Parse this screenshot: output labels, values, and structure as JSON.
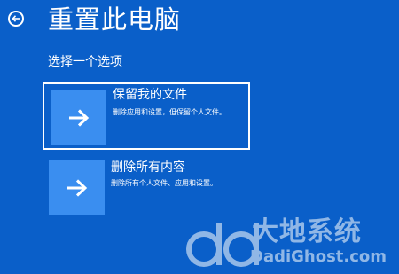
{
  "header": {
    "title": "重置此电脑",
    "back_icon": "back-arrow-icon"
  },
  "subtitle": "选择一个选项",
  "options": [
    {
      "title": "保留我的文件",
      "description": "删除应用和设置，但保留个人文件。",
      "icon": "arrow-right-icon",
      "selected": true
    },
    {
      "title": "删除所有内容",
      "description": "删除所有个人文件、应用和设置。",
      "icon": "arrow-right-icon",
      "selected": false
    }
  ],
  "watermark": {
    "cn": "大地系统",
    "en": "DadiGhost.com"
  },
  "colors": {
    "background": "#0a5fc9",
    "tile": "#3a8ef0",
    "text": "#ffffff"
  }
}
